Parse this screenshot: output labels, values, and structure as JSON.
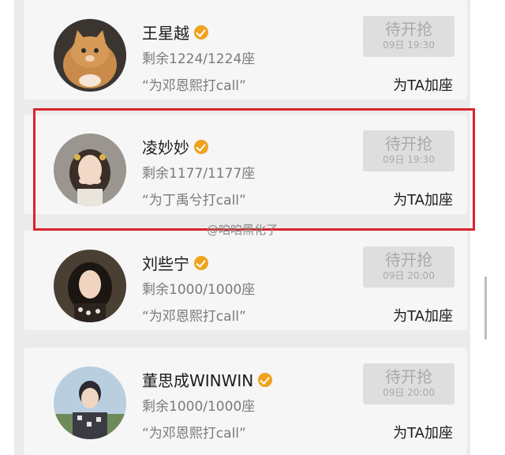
{
  "list": [
    {
      "name": "王星越",
      "remaining": "剩余1224/1224座",
      "slogan": "“为邓恩熙打call”",
      "button_title": "待开抢",
      "button_time": "09日 19:30",
      "add_seat": "为TA加座",
      "avatar_icon": "cat-avatar"
    },
    {
      "name": "凌妙妙",
      "remaining": "剩余1177/1177座",
      "slogan": "“为丁禹兮打call”",
      "button_title": "待开抢",
      "button_time": "09日 19:30",
      "add_seat": "为TA加座",
      "avatar_icon": "woman-avatar"
    },
    {
      "name": "刘些宁",
      "remaining": "剩余1000/1000座",
      "slogan": "“为邓恩熙打call”",
      "button_title": "待开抢",
      "button_time": "09日 20:00",
      "add_seat": "为TA加座",
      "avatar_icon": "woman-avatar"
    },
    {
      "name": "董思成WINWIN",
      "remaining": "剩余1000/1000座",
      "slogan": "“为邓恩熙打call”",
      "button_title": "待开抢",
      "button_time": "09日 20:00",
      "add_seat": "为TA加座",
      "avatar_icon": "man-avatar"
    }
  ],
  "watermark": "@咱咱黑化了",
  "colors": {
    "highlight": "#d7262b",
    "verified": "#f0a21e",
    "button_bg": "#dedede"
  }
}
